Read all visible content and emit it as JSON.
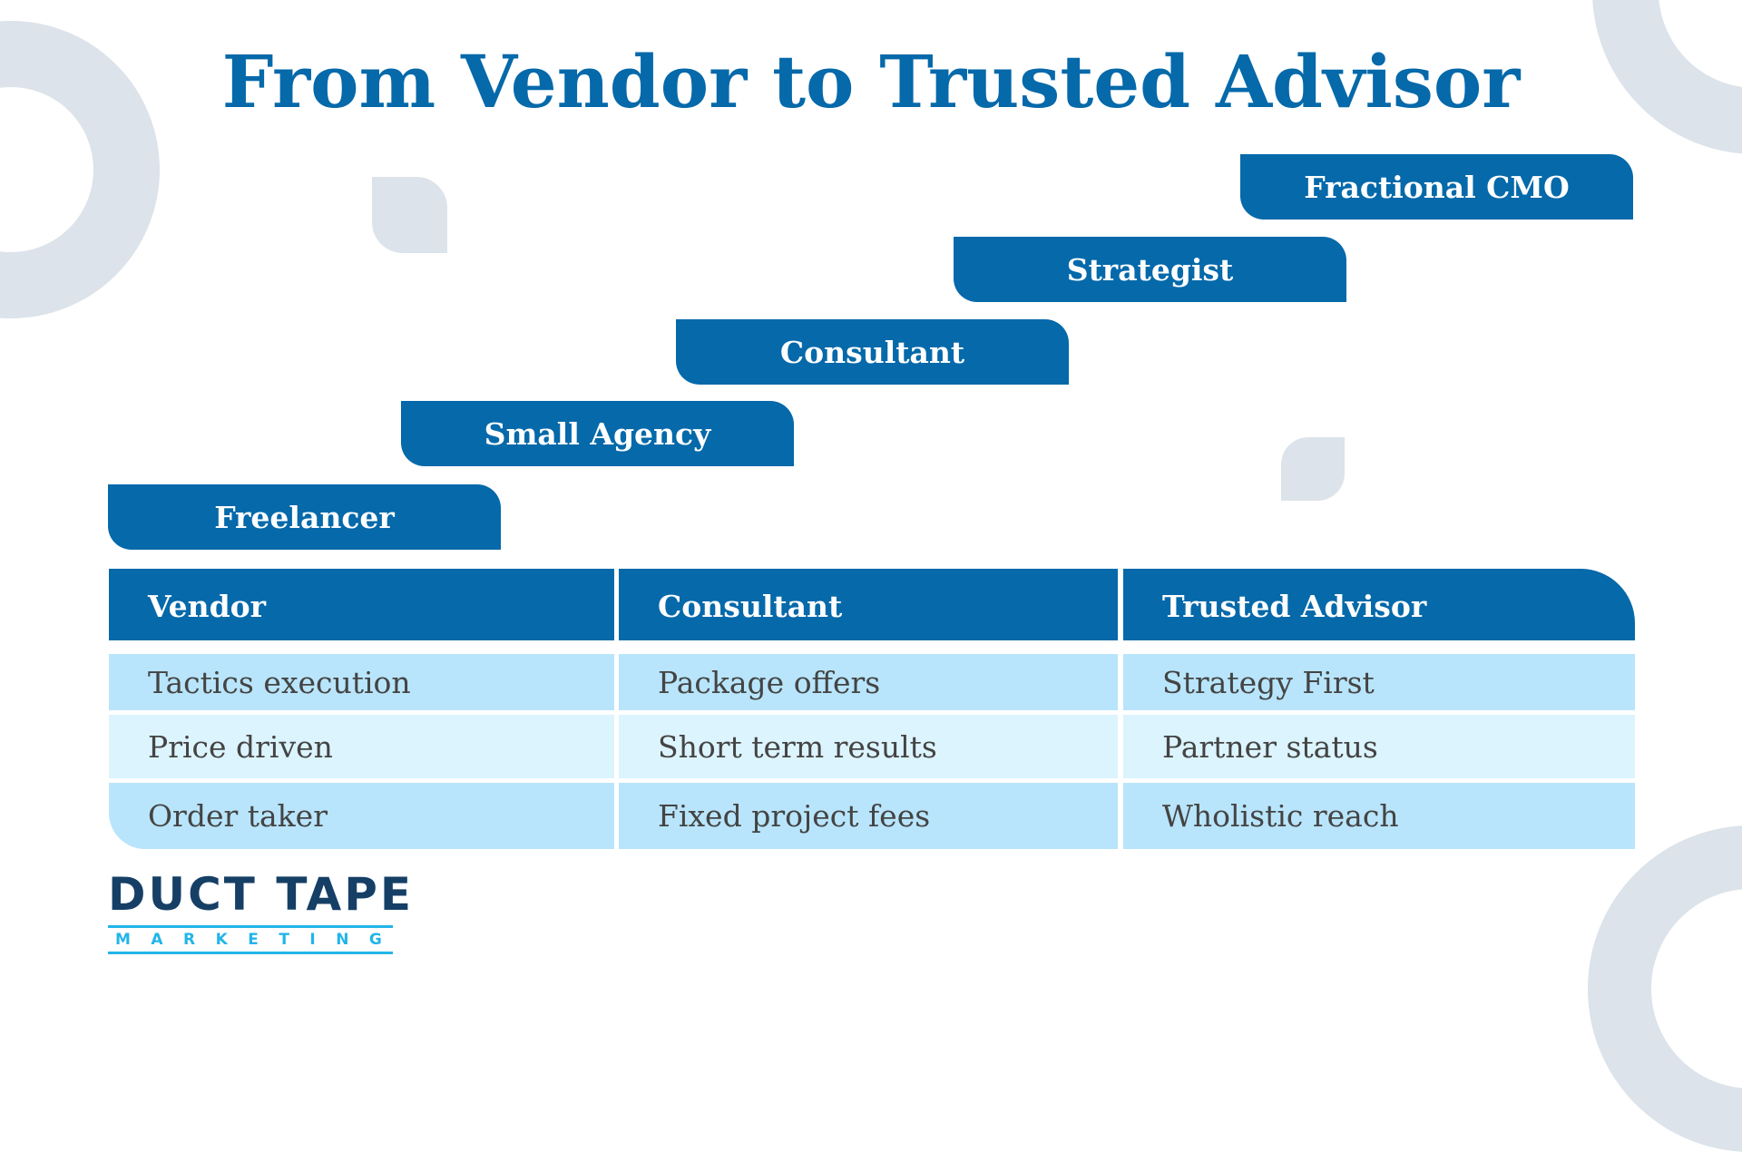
{
  "title": "From Vendor to Trusted Advisor",
  "steps": [
    "Freelancer",
    "Small Agency",
    "Consultant",
    "Strategist",
    "Fractional CMO"
  ],
  "table": {
    "headers": [
      "Vendor",
      "Consultant",
      "Trusted Advisor"
    ],
    "rows": [
      [
        "Tactics execution",
        "Package offers",
        "Strategy First"
      ],
      [
        "Price driven",
        "Short term results",
        "Partner status"
      ],
      [
        "Order taker",
        "Fixed project fees",
        "Wholistic reach"
      ]
    ]
  },
  "logo": {
    "main": "DUCT TAPE",
    "sub": [
      "M",
      "A",
      "R",
      "K",
      "E",
      "T",
      "I",
      "N",
      "G"
    ]
  },
  "colors": {
    "primary": "#0569aa",
    "row_light": "#b8e5fb",
    "row_lighter": "#dcf4fe",
    "decor": "#dce3ea",
    "logo_navy": "#163f66",
    "logo_cyan": "#22b5e8"
  }
}
